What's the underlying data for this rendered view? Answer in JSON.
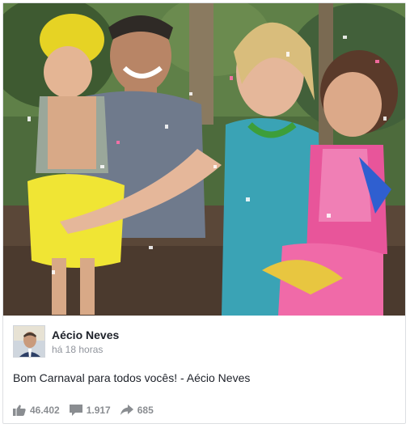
{
  "post": {
    "author_name": "Aécio Neves",
    "time": "há 18 horas",
    "text": "Bom Carnaval para todos vocês! - Aécio Neves"
  },
  "stats": {
    "likes": "46.402",
    "comments": "1.917",
    "shares": "685"
  },
  "icons": {
    "like": "thumbs-up-icon",
    "comment": "comment-bubble-icon",
    "share": "share-arrow-icon"
  },
  "colors": {
    "name": "#1d2129",
    "meta": "#90949c",
    "stat": "#8a8d91",
    "border": "#dddfe2"
  }
}
